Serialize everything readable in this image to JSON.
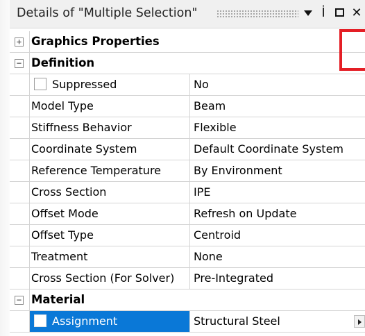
{
  "window": {
    "title": "Details of \"Multiple Selection\"",
    "controls": {
      "dropdown_icon": "dropdown-triangle",
      "pin_glyph": "İ",
      "maximize_icon": "square",
      "close_glyph": "✕"
    }
  },
  "groups": {
    "graphics": {
      "toggle": "+",
      "label": "Graphics Properties"
    },
    "definition": {
      "toggle": "−",
      "label": "Definition"
    },
    "material": {
      "toggle": "−",
      "label": "Material"
    }
  },
  "definition": {
    "rows": [
      {
        "key": "Suppressed",
        "value": "No"
      },
      {
        "key": "Model Type",
        "value": "Beam"
      },
      {
        "key": "Stiffness Behavior",
        "value": "Flexible"
      },
      {
        "key": "Coordinate System",
        "value": "Default Coordinate System"
      },
      {
        "key": "Reference Temperature",
        "value": "By Environment"
      },
      {
        "key": "Cross Section",
        "value": "IPE"
      },
      {
        "key": "Offset Mode",
        "value": "Refresh on Update"
      },
      {
        "key": "Offset Type",
        "value": "Centroid"
      },
      {
        "key": "Treatment",
        "value": "None"
      },
      {
        "key": "Cross Section (For Solver)",
        "value": "Pre-Integrated"
      }
    ]
  },
  "material": {
    "rows": [
      {
        "key": "Assignment",
        "value": "Structural Steel"
      }
    ]
  },
  "colors": {
    "selection": "#0a78d7",
    "highlight": "#e41e25",
    "grid_line": "#d4d4d4"
  }
}
